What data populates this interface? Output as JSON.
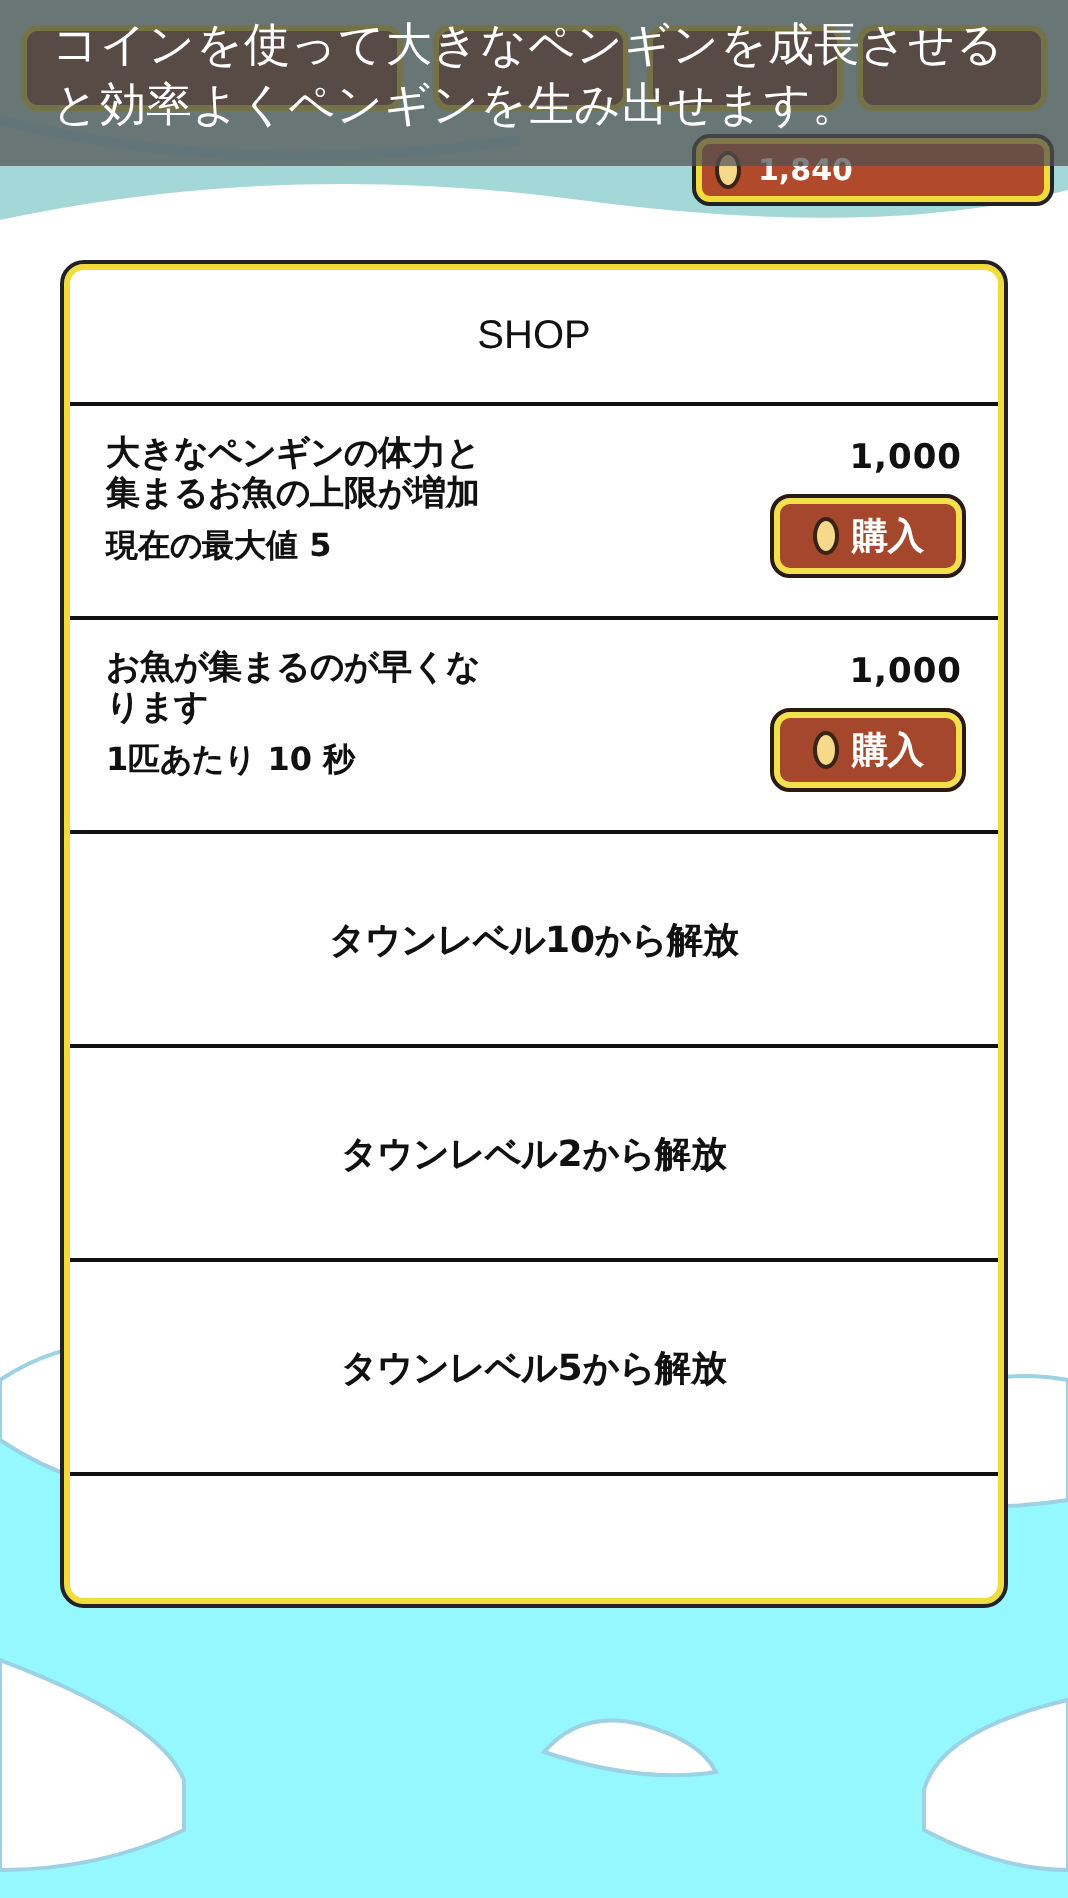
{
  "tutorial": {
    "message": "コインを使って大きなペンギンを成長させると効率よくペンギンを生み出せます。"
  },
  "coins": {
    "amount": "1,840"
  },
  "shop": {
    "title": "SHOP",
    "rows": [
      {
        "kind": "upgrade",
        "description": "大きなペンギンの体力と集まるお魚の上限が増加",
        "stat": "現在の最大値 **5**",
        "price": "1,000",
        "button": "購入"
      },
      {
        "kind": "upgrade",
        "description": "お魚が集まるのが早くなります",
        "stat": "1匹あたり **10** 秒",
        "price": "1,000",
        "button": "購入"
      },
      {
        "kind": "locked",
        "message": "タウンレベル10から解放"
      },
      {
        "kind": "locked",
        "message": "タウンレベル2から解放"
      },
      {
        "kind": "locked",
        "message": "タウンレベル5から解放"
      },
      {
        "kind": "empty"
      }
    ]
  }
}
